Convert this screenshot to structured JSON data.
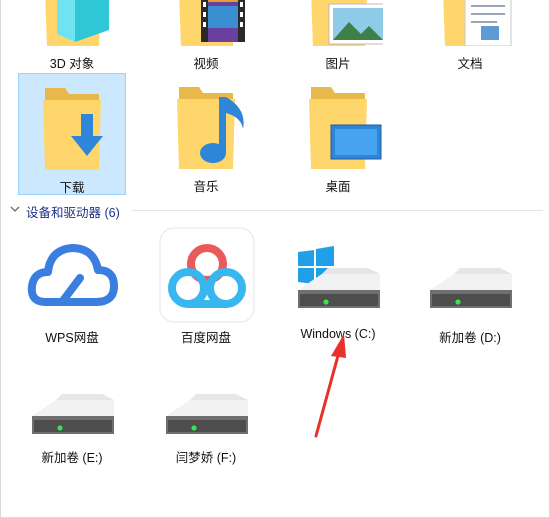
{
  "folders": [
    {
      "label": "3D 对象",
      "icon": "3d-objects-folder-icon"
    },
    {
      "label": "视频",
      "icon": "videos-folder-icon"
    },
    {
      "label": "图片",
      "icon": "pictures-folder-icon"
    },
    {
      "label": "文档",
      "icon": "documents-folder-icon"
    },
    {
      "label": "下载",
      "icon": "downloads-folder-icon",
      "selected": true
    },
    {
      "label": "音乐",
      "icon": "music-folder-icon"
    },
    {
      "label": "桌面",
      "icon": "desktop-folder-icon"
    }
  ],
  "devices_group": {
    "title": "设备和驱动器 (6)",
    "expanded": true
  },
  "devices": [
    {
      "label": "WPS网盘",
      "icon": "wps-cloud-icon"
    },
    {
      "label": "百度网盘",
      "icon": "baidu-netdisk-icon"
    },
    {
      "label": "Windows (C:)",
      "icon": "windows-drive-icon"
    },
    {
      "label": "新加卷 (D:)",
      "icon": "drive-icon"
    },
    {
      "label": "新加卷 (E:)",
      "icon": "drive-icon"
    },
    {
      "label": "闫梦娇 (F:)",
      "icon": "drive-icon"
    }
  ],
  "colors": {
    "selection_bg": "#cce8ff",
    "group_header_text": "#1e3287",
    "folder_yellow": "#ffd66b",
    "annotation_arrow": "#e8312a",
    "windows_blue": "#1fa0e8"
  }
}
